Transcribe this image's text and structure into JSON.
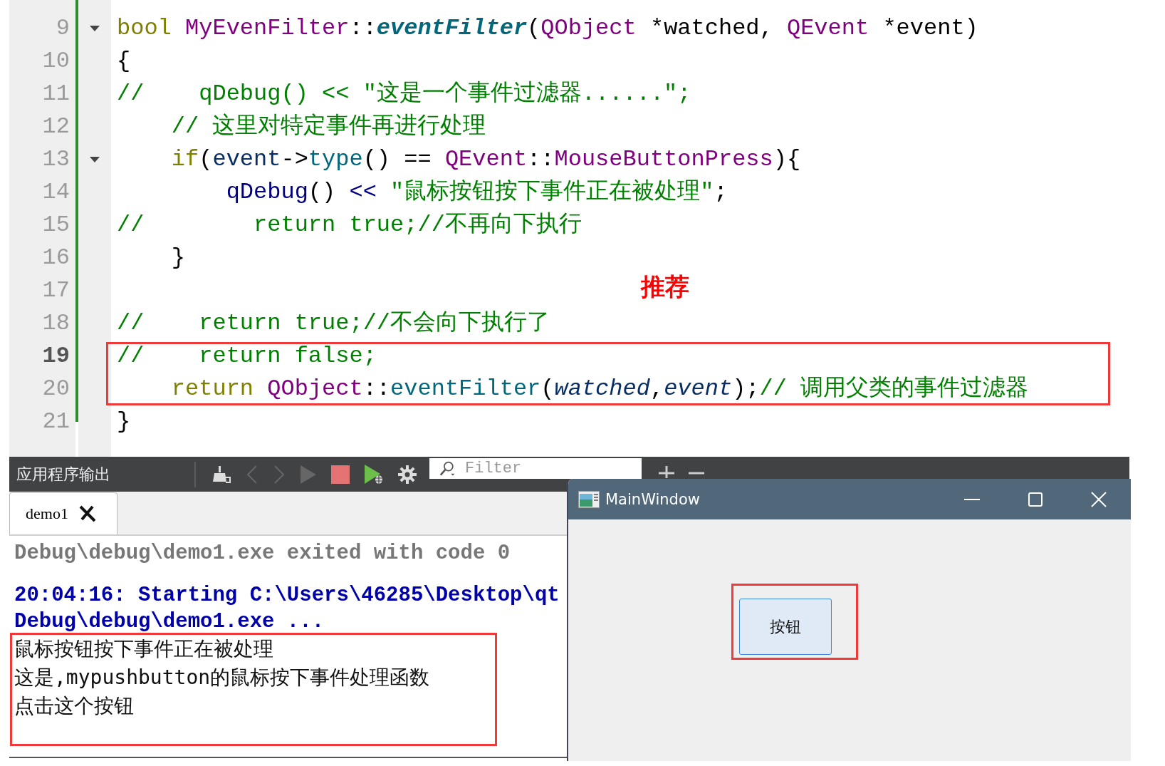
{
  "code_editor": {
    "lines": [
      {
        "number": "9",
        "fold_marker": true,
        "current": false,
        "tokens": [
          {
            "text": "bool ",
            "kind": "keyword"
          },
          {
            "text": "MyEvenFilter",
            "kind": "type"
          },
          {
            "text": "::",
            "kind": "plain"
          },
          {
            "text": "eventFilter",
            "kind": "function-decl"
          },
          {
            "text": "(",
            "kind": "plain"
          },
          {
            "text": "QObject",
            "kind": "type"
          },
          {
            "text": " *watched, ",
            "kind": "plain"
          },
          {
            "text": "QEvent",
            "kind": "type"
          },
          {
            "text": " *event)",
            "kind": "plain"
          }
        ]
      },
      {
        "number": "10",
        "fold_marker": false,
        "current": false,
        "tokens": [
          {
            "text": "{",
            "kind": "plain"
          }
        ]
      },
      {
        "number": "11",
        "fold_marker": false,
        "current": false,
        "tokens": [
          {
            "text": "//    qDebug() << \"这是一个事件过滤器......\";",
            "kind": "comment"
          }
        ]
      },
      {
        "number": "12",
        "fold_marker": false,
        "current": false,
        "tokens": [
          {
            "text": "    // 这里对特定事件再进行处理",
            "kind": "comment"
          }
        ]
      },
      {
        "number": "13",
        "fold_marker": true,
        "current": false,
        "tokens": [
          {
            "text": "    if",
            "kind": "keyword"
          },
          {
            "text": "(",
            "kind": "plain"
          },
          {
            "text": "event",
            "kind": "local"
          },
          {
            "text": "->",
            "kind": "plain"
          },
          {
            "text": "type",
            "kind": "function"
          },
          {
            "text": "() == ",
            "kind": "plain"
          },
          {
            "text": "QEvent",
            "kind": "type"
          },
          {
            "text": "::",
            "kind": "plain"
          },
          {
            "text": "MouseButtonPress",
            "kind": "type"
          },
          {
            "text": "){",
            "kind": "plain"
          }
        ]
      },
      {
        "number": "14",
        "fold_marker": false,
        "current": false,
        "tokens": [
          {
            "text": "        qDebug",
            "kind": "macro"
          },
          {
            "text": "() ",
            "kind": "plain"
          },
          {
            "text": "<< ",
            "kind": "macro"
          },
          {
            "text": "\"鼠标按钮按下事件正在被处理\"",
            "kind": "string"
          },
          {
            "text": ";",
            "kind": "plain"
          }
        ]
      },
      {
        "number": "15",
        "fold_marker": false,
        "current": false,
        "tokens": [
          {
            "text": "//        return true;//不再向下执行",
            "kind": "comment"
          }
        ]
      },
      {
        "number": "16",
        "fold_marker": false,
        "current": false,
        "tokens": [
          {
            "text": "    }",
            "kind": "plain"
          }
        ]
      },
      {
        "number": "17",
        "fold_marker": false,
        "current": false
      },
      {
        "number": "18",
        "fold_marker": false,
        "current": false,
        "tokens": [
          {
            "text": "//    return true;//不会向下执行了",
            "kind": "comment"
          }
        ]
      },
      {
        "number": "19",
        "fold_marker": false,
        "current": true,
        "tokens": [
          {
            "text": "//    return false;",
            "kind": "comment"
          }
        ]
      },
      {
        "number": "20",
        "fold_marker": false,
        "current": false,
        "tokens": [
          {
            "text": "    return ",
            "kind": "keyword"
          },
          {
            "text": "QObject",
            "kind": "type"
          },
          {
            "text": "::",
            "kind": "plain"
          },
          {
            "text": "eventFilter",
            "kind": "function"
          },
          {
            "text": "(",
            "kind": "plain"
          },
          {
            "text": "watched",
            "kind": "param"
          },
          {
            "text": ",",
            "kind": "plain"
          },
          {
            "text": "event",
            "kind": "param"
          },
          {
            "text": ");",
            "kind": "plain"
          },
          {
            "text": "// 调用父类的事件过滤器",
            "kind": "comment"
          }
        ]
      },
      {
        "number": "21",
        "fold_marker": false,
        "current": false,
        "tokens": [
          {
            "text": "}",
            "kind": "plain"
          }
        ]
      }
    ],
    "annotation": "推荐"
  },
  "output_pane": {
    "title": "应用程序输出",
    "filter": {
      "placeholder": "Filter"
    },
    "tabs": [
      {
        "label": "demo1",
        "selected": true
      }
    ],
    "lines": [
      {
        "text": "Debug\\debug\\demo1.exe exited with code 0",
        "kind": "status"
      },
      {
        "text": "20:04:16: Starting C:\\Users\\46285\\Desktop\\qt",
        "kind": "start"
      },
      {
        "text": "Debug\\debug\\demo1.exe ...",
        "kind": "start"
      },
      {
        "text": "鼠标按钮按下事件正在被处理",
        "kind": "program"
      },
      {
        "text": "这是,mypushbutton的鼠标按下事件处理函数",
        "kind": "program"
      },
      {
        "text": "点击这个按钮",
        "kind": "program"
      }
    ]
  },
  "main_window": {
    "title": "MainWindow",
    "button": "按钮"
  }
}
